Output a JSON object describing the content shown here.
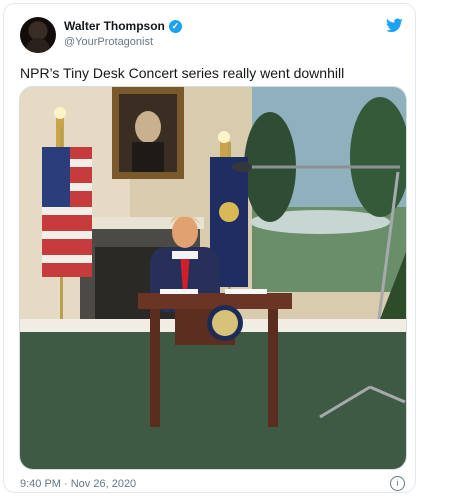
{
  "author": {
    "display_name": "Walter Thompson",
    "handle": "@YourProtagonist",
    "verified_icon": "verified-badge-icon"
  },
  "brand_icon": "twitter-bird-icon",
  "tweet": {
    "text": "NPR’s Tiny Desk Concert series really went downhill",
    "timestamp": "9:40 PM · Nov 26, 2020",
    "info_icon": "info-icon"
  },
  "colors": {
    "twitter_blue": "#1da1f2",
    "text_primary": "#14171a",
    "text_secondary": "#657786",
    "carpet_green": "#3e5a45"
  }
}
